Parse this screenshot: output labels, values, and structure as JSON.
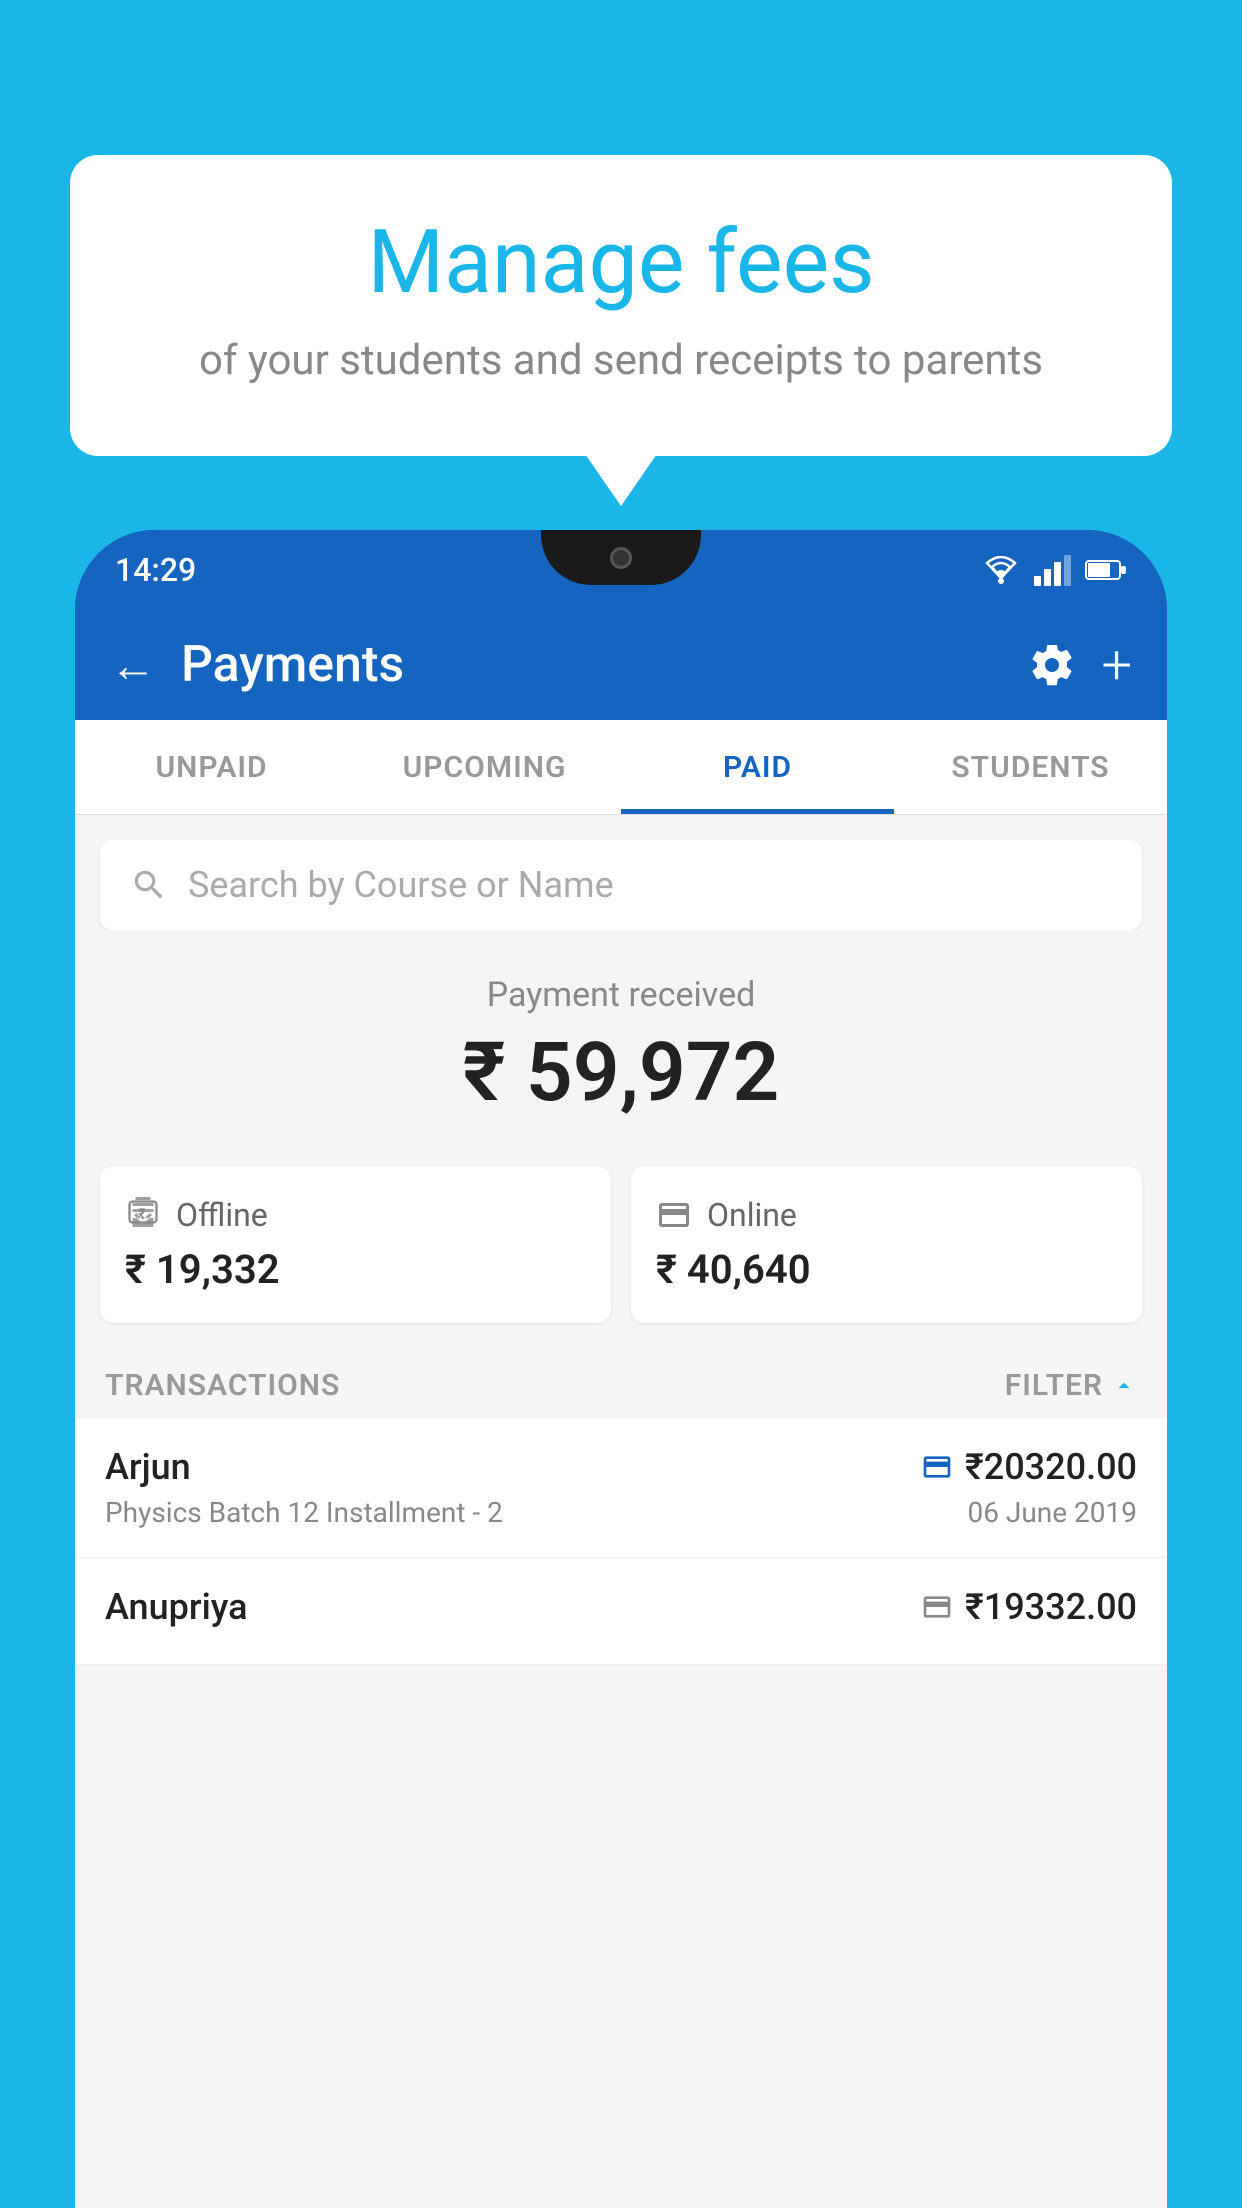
{
  "background_color": "#1ab6e8",
  "bubble": {
    "title": "Manage fees",
    "subtitle": "of your students and send receipts to parents"
  },
  "phone": {
    "status_time": "14:29",
    "header": {
      "title": "Payments",
      "back_label": "←",
      "plus_label": "+"
    },
    "tabs": [
      {
        "label": "UNPAID",
        "active": false
      },
      {
        "label": "UPCOMING",
        "active": false
      },
      {
        "label": "PAID",
        "active": true
      },
      {
        "label": "STUDENTS",
        "active": false
      }
    ],
    "search": {
      "placeholder": "Search by Course or Name"
    },
    "payment_received": {
      "label": "Payment received",
      "amount": "₹ 59,972",
      "offline": {
        "label": "Offline",
        "amount": "₹ 19,332"
      },
      "online": {
        "label": "Online",
        "amount": "₹ 40,640"
      }
    },
    "transactions": {
      "section_label": "TRANSACTIONS",
      "filter_label": "FILTER",
      "items": [
        {
          "name": "Arjun",
          "amount": "₹20320.00",
          "course": "Physics Batch 12 Installment - 2",
          "date": "06 June 2019",
          "type": "online"
        },
        {
          "name": "Anupriya",
          "amount": "₹19332.00",
          "course": "",
          "date": "",
          "type": "offline"
        }
      ]
    }
  }
}
